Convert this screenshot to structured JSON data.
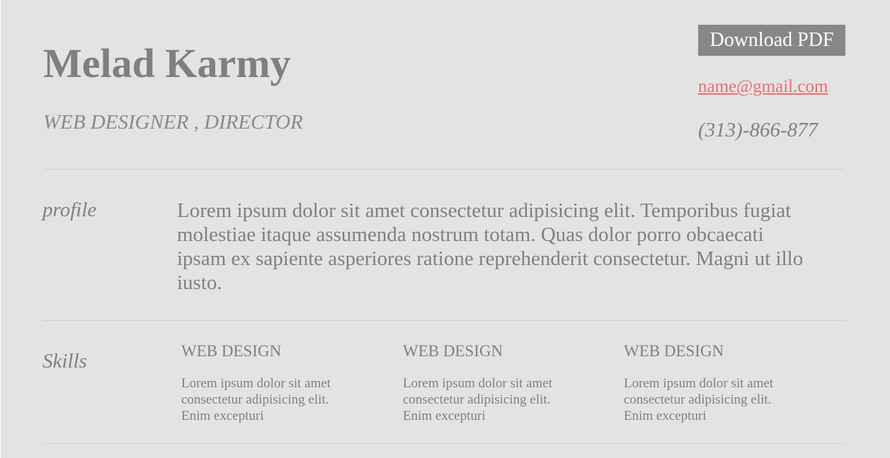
{
  "header": {
    "name": "Melad Karmy",
    "title": "WEB DESIGNER , DIRECTOR",
    "download_label": "Download PDF",
    "email": "name@gmail.com",
    "phone": "(313)-866-877"
  },
  "profile": {
    "label": "profile",
    "text": "Lorem ipsum dolor sit amet consectetur adipisicing elit. Temporibus fugiat molestiae itaque assumenda nostrum totam. Quas dolor porro obcaecati ipsam ex sapiente asperiores ratione reprehenderit consectetur. Magni ut illo iusto."
  },
  "skills": {
    "label": "Skills",
    "items": [
      {
        "title": "WEB DESIGN",
        "desc": "Lorem ipsum dolor sit amet consectetur adipisicing elit. Enim excepturi"
      },
      {
        "title": "WEB DESIGN",
        "desc": "Lorem ipsum dolor sit amet consectetur adipisicing elit. Enim excepturi"
      },
      {
        "title": "WEB DESIGN",
        "desc": "Lorem ipsum dolor sit amet consectetur adipisicing elit. Enim excepturi"
      }
    ]
  },
  "colors": {
    "background": "#e3e3e3",
    "text": "#808080",
    "link": "#f26b6b",
    "button": "#878787"
  }
}
